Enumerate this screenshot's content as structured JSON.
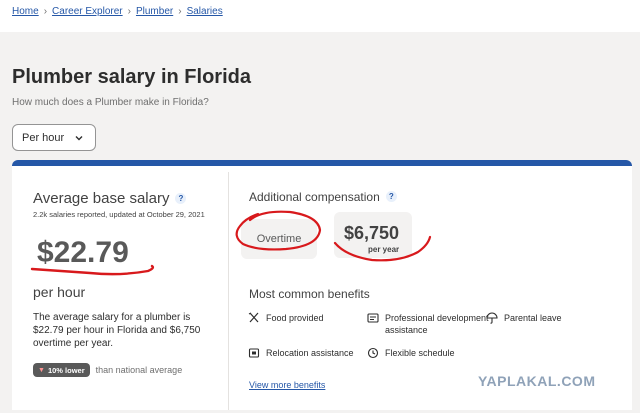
{
  "breadcrumb": {
    "items": [
      "Home",
      "Career Explorer",
      "Plumber",
      "Salaries"
    ]
  },
  "header": {
    "title": "Plumber salary in Florida",
    "subtitle": "How much does a Plumber make in Florida?"
  },
  "period_select": {
    "selected": "Per hour"
  },
  "base_salary": {
    "title": "Average base salary",
    "info": "?",
    "reported": "2.2k salaries reported, updated at October 29, 2021",
    "value": "$22.79",
    "period": "per hour",
    "description": "The average salary for a plumber is $22.79 per hour in Florida and $6,750 overtime per year.",
    "badge": "10% lower",
    "badge_suffix": "than national average"
  },
  "additional": {
    "title": "Additional compensation",
    "info": "?",
    "overtime_label": "Overtime",
    "overtime_amount": "$6,750",
    "overtime_period": "per year"
  },
  "benefits": {
    "title": "Most common benefits",
    "items": [
      {
        "label": "Food provided",
        "icon": "utensils-icon"
      },
      {
        "label": "Professional development assistance",
        "icon": "certificate-icon"
      },
      {
        "label": "Parental leave",
        "icon": "umbrella-icon"
      },
      {
        "label": "Relocation assistance",
        "icon": "relocation-icon"
      },
      {
        "label": "Flexible schedule",
        "icon": "clock-icon"
      }
    ],
    "view_more": "View more benefits"
  },
  "watermark": "YAPLAKAL.COM",
  "colors": {
    "accent": "#2557a7",
    "annotation_red": "#d8191c"
  }
}
